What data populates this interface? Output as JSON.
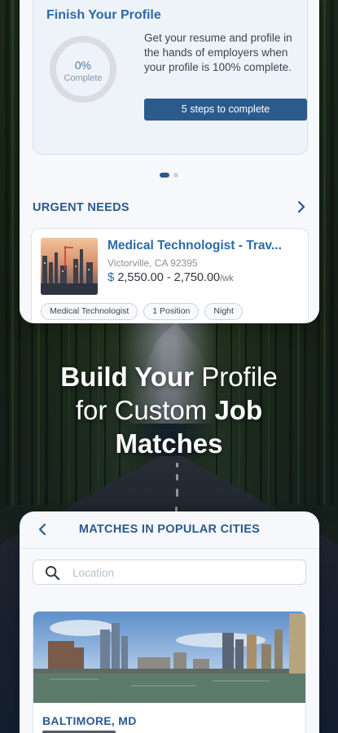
{
  "profile_card": {
    "title": "Finish Your Profile",
    "progress_percent_label": "0%",
    "progress_fraction": 0,
    "progress_caption": "Complete",
    "description": "Get your resume and profile in the hands of employers when your profile is 100% complete.",
    "steps_button_label": "5 steps to complete"
  },
  "carousel": {
    "page_count": 2,
    "active_index": 0
  },
  "urgent_needs": {
    "title": "URGENT NEEDS",
    "job": {
      "title": "Medical Technologist - Trav...",
      "location": "Victorville, CA 92395",
      "currency_symbol": "$",
      "pay_range": "2,550.00 - 2,750.00",
      "pay_unit": "/wk",
      "tags": [
        "Medical Technologist",
        "1 Position",
        "Night"
      ]
    }
  },
  "headline": {
    "line1_bold": "Build Your",
    "line1_regular": " Profile",
    "line2_regular": "for Custom ",
    "line2_bold": "Job",
    "line3_bold": "Matches"
  },
  "popular_cities": {
    "title": "MATCHES IN POPULAR CITIES",
    "search_placeholder": "Location",
    "city": {
      "name": "BALTIMORE, MD"
    }
  },
  "colors": {
    "accent": "#2b5a8d",
    "title_blue": "#2d6aa8",
    "card_bg": "#f6f8fb"
  },
  "icons": {
    "urgent_chevron": "chevron-right-icon",
    "back": "chevron-left-icon",
    "search": "search-icon"
  }
}
